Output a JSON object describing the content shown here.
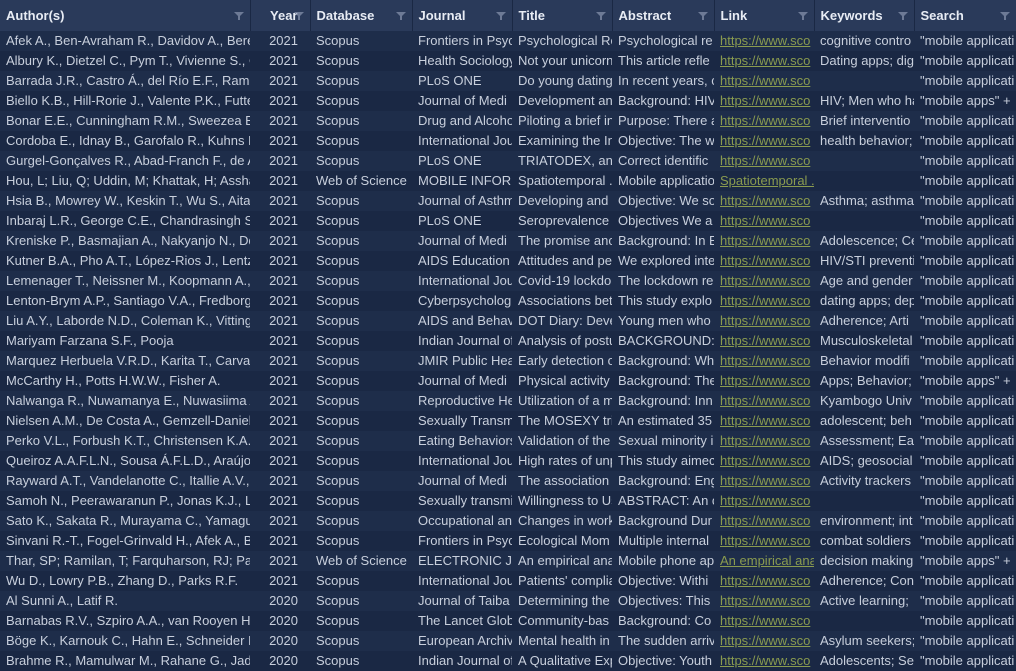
{
  "columns": [
    {
      "id": "authors",
      "label": "Author(s)"
    },
    {
      "id": "year",
      "label": "Year"
    },
    {
      "id": "database",
      "label": "Database"
    },
    {
      "id": "journal",
      "label": "Journal"
    },
    {
      "id": "title",
      "label": "Title"
    },
    {
      "id": "abstract",
      "label": "Abstract"
    },
    {
      "id": "link",
      "label": "Link"
    },
    {
      "id": "keywords",
      "label": "Keywords"
    },
    {
      "id": "search",
      "label": "Search"
    }
  ],
  "link_default_text": "https://www.sco",
  "rows": [
    {
      "authors": "Afek A., Ben-Avraham R., Davidov A., Bere",
      "year": "2021",
      "database": "Scopus",
      "journal": "Frontiers in Psyc",
      "title": "Psychological Re",
      "abstract": "Psychological re",
      "link": "https://www.sco",
      "keywords": "cognitive contro",
      "search": "\"mobile applicati"
    },
    {
      "authors": "Albury K., Dietzel C., Pym T., Vivienne S., C",
      "year": "2021",
      "database": "Scopus",
      "journal": "Health Sociology",
      "title": "Not your unicorn",
      "abstract": "This article refle",
      "link": "https://www.sco",
      "keywords": "Dating apps; dig",
      "search": "\"mobile applicati"
    },
    {
      "authors": "Barrada J.R., Castro Á., del Río E.F., Ramos",
      "year": "2021",
      "database": "Scopus",
      "journal": "PLoS ONE",
      "title": "Do young dating",
      "abstract": "In recent years, c",
      "link": "https://www.sco",
      "keywords": "",
      "search": "\"mobile applicati"
    },
    {
      "authors": "Biello K.B., Hill-Rorie J., Valente P.K., Futter",
      "year": "2021",
      "database": "Scopus",
      "journal": "Journal of Medi",
      "title": "Development an",
      "abstract": "Background: HIV",
      "link": "https://www.sco",
      "keywords": "HIV; Men who ha",
      "search": "\"mobile apps\" + "
    },
    {
      "authors": "Bonar E.E., Cunningham R.M., Sweezea E.C",
      "year": "2021",
      "database": "Scopus",
      "journal": "Drug and Alcoho",
      "title": "Piloting a brief in",
      "abstract": "Purpose: There a",
      "link": "https://www.sco",
      "keywords": "Brief interventio",
      "search": "\"mobile applicati"
    },
    {
      "authors": "Cordoba E., Idnay B., Garofalo R., Kuhns L.",
      "year": "2021",
      "database": "Scopus",
      "journal": "International Jou",
      "title": "Examining the In",
      "abstract": "Objective: The w",
      "link": "https://www.sco",
      "keywords": "health behavior;",
      "search": "\"mobile applicati"
    },
    {
      "authors": "Gurgel-Gonçalves R., Abad-Franch F., de A",
      "year": "2021",
      "database": "Scopus",
      "journal": "PLoS ONE",
      "title": "TRIATODEX, an e",
      "abstract": "Correct identific",
      "link": "https://www.sco",
      "keywords": "",
      "search": "\"mobile applicati"
    },
    {
      "authors": "Hou, L; Liu, Q; Uddin, M; Khattak, H; Asshad",
      "year": "2021",
      "database": "Web of Science",
      "journal": "MOBILE INFORM",
      "title": "Spatiotemporal .",
      "abstract": "Mobile applicatio",
      "link_text": "Spatiotemporal .",
      "keywords": "",
      "search": "\"mobile applicati"
    },
    {
      "authors": "Hsia B., Mowrey W., Keskin T., Wu S., Aita R",
      "year": "2021",
      "database": "Scopus",
      "journal": "Journal of Asthm",
      "title": "Developing and",
      "abstract": "Objective: We so",
      "link": "https://www.sco",
      "keywords": "Asthma; asthma",
      "search": "\"mobile applicati"
    },
    {
      "authors": "Inbaraj L.R., George C.E., Chandrasingh S.",
      "year": "2021",
      "database": "Scopus",
      "journal": "PLoS ONE",
      "title": "Seroprevalence",
      "abstract": "Objectives We a",
      "link": "https://www.sco",
      "keywords": "",
      "search": "\"mobile applicati"
    },
    {
      "authors": "Kreniske P., Basmajian A., Nakyanjo N., Dda",
      "year": "2021",
      "database": "Scopus",
      "journal": "Journal of Medi",
      "title": "The promise anc",
      "abstract": "Background: In E",
      "link": "https://www.sco",
      "keywords": "Adolescence; Ce",
      "search": "\"mobile applicati"
    },
    {
      "authors": "Kutner B.A., Pho A.T., López-Rios J., Lentz",
      "year": "2021",
      "database": "Scopus",
      "journal": "AIDS Education a",
      "title": "Attitudes and pe",
      "abstract": "We explored inte",
      "link": "https://www.sco",
      "keywords": "HIV/STI preventi",
      "search": "\"mobile applicati"
    },
    {
      "authors": "Lemenager T., Neissner M., Koopmann A.,",
      "year": "2021",
      "database": "Scopus",
      "journal": "International Jou",
      "title": "Covid-19 lockdo",
      "abstract": "The lockdown re",
      "link": "https://www.sco",
      "keywords": "Age and gender",
      "search": "\"mobile applicati"
    },
    {
      "authors": "Lenton-Brym A.P., Santiago V.A., Fredborg",
      "year": "2021",
      "database": "Scopus",
      "journal": "Cyberpsycholog",
      "title": "Associations bet",
      "abstract": "This study explo",
      "link": "https://www.sco",
      "keywords": "dating apps; dep",
      "search": "\"mobile applicati"
    },
    {
      "authors": "Liu A.Y., Laborde N.D., Coleman K., Vitting",
      "year": "2021",
      "database": "Scopus",
      "journal": "AIDS and Behavi",
      "title": "DOT Diary: Deve",
      "abstract": "Young men who",
      "link": "https://www.sco",
      "keywords": "Adherence; Arti",
      "search": "\"mobile applicati"
    },
    {
      "authors": "Mariyam Farzana S.F., Pooja",
      "year": "2021",
      "database": "Scopus",
      "journal": "Indian Journal of",
      "title": "Analysis of postu",
      "abstract": "BACKGROUND:",
      "link": "https://www.sco",
      "keywords": "Musculoskeletal",
      "search": "\"mobile applicati"
    },
    {
      "authors": "Marquez Herbuela V.R.D., Karita T., Carvaja",
      "year": "2021",
      "database": "Scopus",
      "journal": "JMIR Public Hea",
      "title": "Early detection o",
      "abstract": "Background: Wh",
      "link": "https://www.sco",
      "keywords": "Behavior modifi",
      "search": "\"mobile applicati"
    },
    {
      "authors": "McCarthy H., Potts H.W.W., Fisher A.",
      "year": "2021",
      "database": "Scopus",
      "journal": "Journal of Medi",
      "title": "Physical activity",
      "abstract": "Background: The",
      "link": "https://www.sco",
      "keywords": "Apps; Behavior;",
      "search": "\"mobile apps\" + "
    },
    {
      "authors": "Nalwanga R., Nuwamanya E., Nuwasiima A",
      "year": "2021",
      "database": "Scopus",
      "journal": "Reproductive He",
      "title": "Utilization of a m",
      "abstract": "Background: Inn",
      "link": "https://www.sco",
      "keywords": "Kyambogo Univ",
      "search": "\"mobile applicati"
    },
    {
      "authors": "Nielsen A.M., De Costa A., Gemzell-Daniel",
      "year": "2021",
      "database": "Scopus",
      "journal": "Sexually Transmi",
      "title": "The MOSEXY tri",
      "abstract": "An estimated 35",
      "link": "https://www.sco",
      "keywords": "adolescent; beh",
      "search": "\"mobile applicati"
    },
    {
      "authors": "Perko V.L., Forbush K.T., Christensen K.A., ",
      "year": "2021",
      "database": "Scopus",
      "journal": "Eating Behaviors",
      "title": "Validation of the",
      "abstract": "Sexual minority i",
      "link": "https://www.sco",
      "keywords": "Assessment; Eat",
      "search": "\"mobile applicati"
    },
    {
      "authors": "Queiroz A.A.F.L.N., Sousa Á.F.L.D., Araújo T",
      "year": "2021",
      "database": "Scopus",
      "journal": "International Jou",
      "title": "High rates of unp",
      "abstract": "This study aimec",
      "link": "https://www.sco",
      "keywords": "AIDS; geosocial",
      "search": "\"mobile applicati"
    },
    {
      "authors": "Rayward A.T., Vandelanotte C., Itallie A.V., D",
      "year": "2021",
      "database": "Scopus",
      "journal": "Journal of Medi",
      "title": "The association",
      "abstract": "Background: Eng",
      "link": "https://www.sco",
      "keywords": "Activity trackers",
      "search": "\"mobile applicati"
    },
    {
      "authors": "Samoh N., Peerawaranun P., Jonas K.J., Lin",
      "year": "2021",
      "database": "Scopus",
      "journal": "Sexually transmi",
      "title": "Willingness to Us",
      "abstract": "ABSTRACT: An c",
      "link": "https://www.sco",
      "keywords": "",
      "search": "\"mobile applicati"
    },
    {
      "authors": "Sato K., Sakata R., Murayama C., Yamagucl",
      "year": "2021",
      "database": "Scopus",
      "journal": "Occupational an",
      "title": "Changes in work",
      "abstract": "Background Dur",
      "link": "https://www.sco",
      "keywords": "environment; int",
      "search": "\"mobile applicati"
    },
    {
      "authors": "Sinvani R.-T., Fogel-Grinvald H., Afek A., Be",
      "year": "2021",
      "database": "Scopus",
      "journal": "Frontiers in Psyc",
      "title": "Ecological Mom",
      "abstract": "Multiple internal",
      "link": "https://www.sco",
      "keywords": "combat soldiers",
      "search": "\"mobile applicati"
    },
    {
      "authors": "Thar, SP; Ramilan, T; Farquharson, RJ; Pang",
      "year": "2021",
      "database": "Web of Science",
      "journal": "ELECTRONIC JO",
      "title": "An empirical ana",
      "abstract": "Mobile phone ap",
      "link_text": "An empirical ana",
      "keywords": "decision making",
      "search": "\"mobile apps\" + "
    },
    {
      "authors": "Wu D., Lowry P.B., Zhang D., Parks R.F.",
      "year": "2021",
      "database": "Scopus",
      "journal": "International Jou",
      "title": "Patients' complia",
      "abstract": "Objective: Withi",
      "link": "https://www.sco",
      "keywords": "Adherence; Con",
      "search": "\"mobile applicati"
    },
    {
      "authors": "Al Sunni A., Latif R.",
      "year": "2020",
      "database": "Scopus",
      "journal": "Journal of Taiba",
      "title": "Determining the",
      "abstract": "Objectives: This",
      "link": "https://www.sco",
      "keywords": "Active learning;",
      "search": "\"mobile applicati"
    },
    {
      "authors": "Barnabas R.V., Szpiro A.A., van Rooyen H., ",
      "year": "2020",
      "database": "Scopus",
      "journal": "The Lancet Glob",
      "title": "Community-bas",
      "abstract": "Background: Co",
      "link": "https://www.sco",
      "keywords": "",
      "search": "\"mobile applicati"
    },
    {
      "authors": "Böge K., Karnouk C., Hahn E., Schneider F.",
      "year": "2020",
      "database": "Scopus",
      "journal": "European Archiv",
      "title": "Mental health in",
      "abstract": "The sudden arriv",
      "link": "https://www.sco",
      "keywords": "Asylum seekers;",
      "search": "\"mobile applicati"
    },
    {
      "authors": "Brahme R., Mamulwar M., Rahane G., Jadh",
      "year": "2020",
      "database": "Scopus",
      "journal": "Indian Journal of",
      "title": "A Qualitative Exp",
      "abstract": "Objective: Youth",
      "link": "https://www.sco",
      "keywords": "Adolescents; Se",
      "search": "\"mobile applicati"
    }
  ]
}
